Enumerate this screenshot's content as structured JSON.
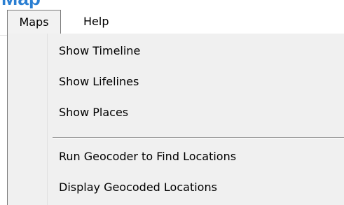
{
  "window": {
    "title_fragment": "Map"
  },
  "menubar": {
    "items": [
      {
        "label": "Maps",
        "open": true
      },
      {
        "label": "Help",
        "open": false
      }
    ]
  },
  "dropdown": {
    "group1": [
      {
        "label": "Show Timeline"
      },
      {
        "label": "Show Lifelines"
      },
      {
        "label": "Show Places"
      }
    ],
    "group2": [
      {
        "label": "Run Geocoder to Find Locations"
      },
      {
        "label": "Display Geocoded Locations"
      }
    ]
  },
  "colors": {
    "accent": "#2b7fd2",
    "menu_background": "#f0f0f0",
    "border": "#7a7a7a"
  }
}
